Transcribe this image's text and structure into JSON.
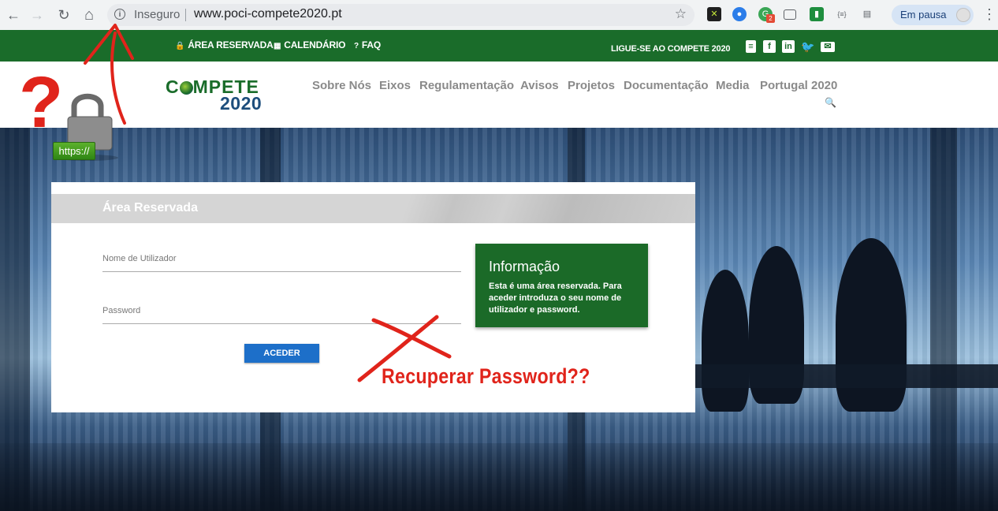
{
  "browser": {
    "nav": {
      "back": "←",
      "forward": "→",
      "reload": "↻",
      "home": "⌂"
    },
    "omnibox": {
      "security_label": "Inseguro",
      "url": "www.poci-compete2020.pt",
      "info_icon": "i"
    },
    "extensions": [
      "ext-x-icon",
      "ext-chat-icon",
      "ext-badge-icon",
      "cast-icon",
      "ext-green-icon",
      "ext-brackets-icon",
      "ext-doc-icon"
    ],
    "ext_badge_count": "2",
    "profile": {
      "label": "Em pausa"
    }
  },
  "topbar": {
    "links": [
      {
        "icon": "🔒",
        "label": "ÁREA RESERVADA"
      },
      {
        "icon": "▦",
        "label": "CALENDÁRIO"
      },
      {
        "icon": "?",
        "label": "FAQ"
      }
    ],
    "connect_label": "LIGUE-SE AO COMPETE 2020",
    "social": [
      "document-icon",
      "facebook-icon",
      "linkedin-icon",
      "twitter-icon",
      "email-icon"
    ]
  },
  "header": {
    "logo": {
      "line1_a": "C",
      "line1_b": "MPETE",
      "line2": "2020"
    },
    "nav": [
      "Sobre Nós",
      "Eixos",
      "Regulamentação",
      "Avisos",
      "Projetos",
      "Documentação",
      "Media",
      "Portugal 2020"
    ]
  },
  "login": {
    "title": "Área Reservada",
    "username_label": "Nome de Utilizador",
    "password_label": "Password",
    "submit_label": "ACEDER",
    "info": {
      "title": "Informação",
      "text": "Esta é uma área reservada. Para aceder introduza o seu nome de utilizador e password."
    }
  },
  "annotations": {
    "recover_text": "Recuperar  Password??",
    "question_mark": "?",
    "https_badge": "https://",
    "color": "#e0241b"
  },
  "colors": {
    "brand_green": "#1a6c2a",
    "brand_blue": "#1d4e7c",
    "button_blue": "#1d6fc9"
  }
}
